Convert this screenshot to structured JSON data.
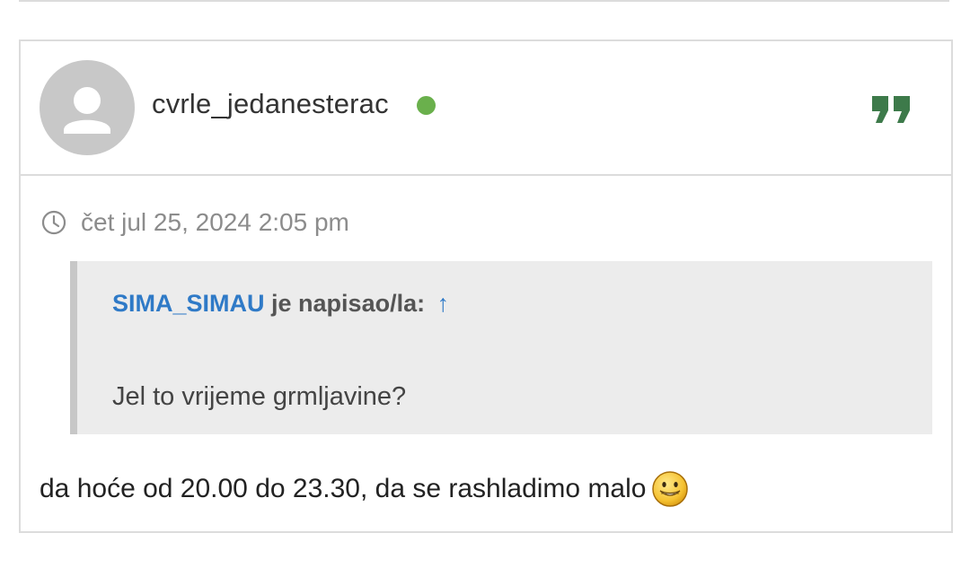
{
  "post": {
    "author": {
      "username": "cvrle_jedanesterac",
      "online": true,
      "online_color": "#6ab04c",
      "avatar_icon": "default-user-avatar-icon"
    },
    "quote_button_icon": "quote-icon",
    "timestamp": "čet jul 25, 2024 2:05 pm",
    "blockquote": {
      "cited_user": "SIMA_SIMAU",
      "cite_suffix": "je napisao/la:",
      "jump_arrow": "↑",
      "text": "Jel to vrijeme grmljavine?"
    },
    "body_text": "da hoće od 20.00 do 23.30, da se rashladimo malo",
    "emoji_icon": "grinning-sweat-smiley-icon"
  },
  "colors": {
    "link": "#2f7ac7",
    "quote_icon": "#3d7a4a",
    "border": "#dcdcdc",
    "quote_bg": "#ececec"
  }
}
